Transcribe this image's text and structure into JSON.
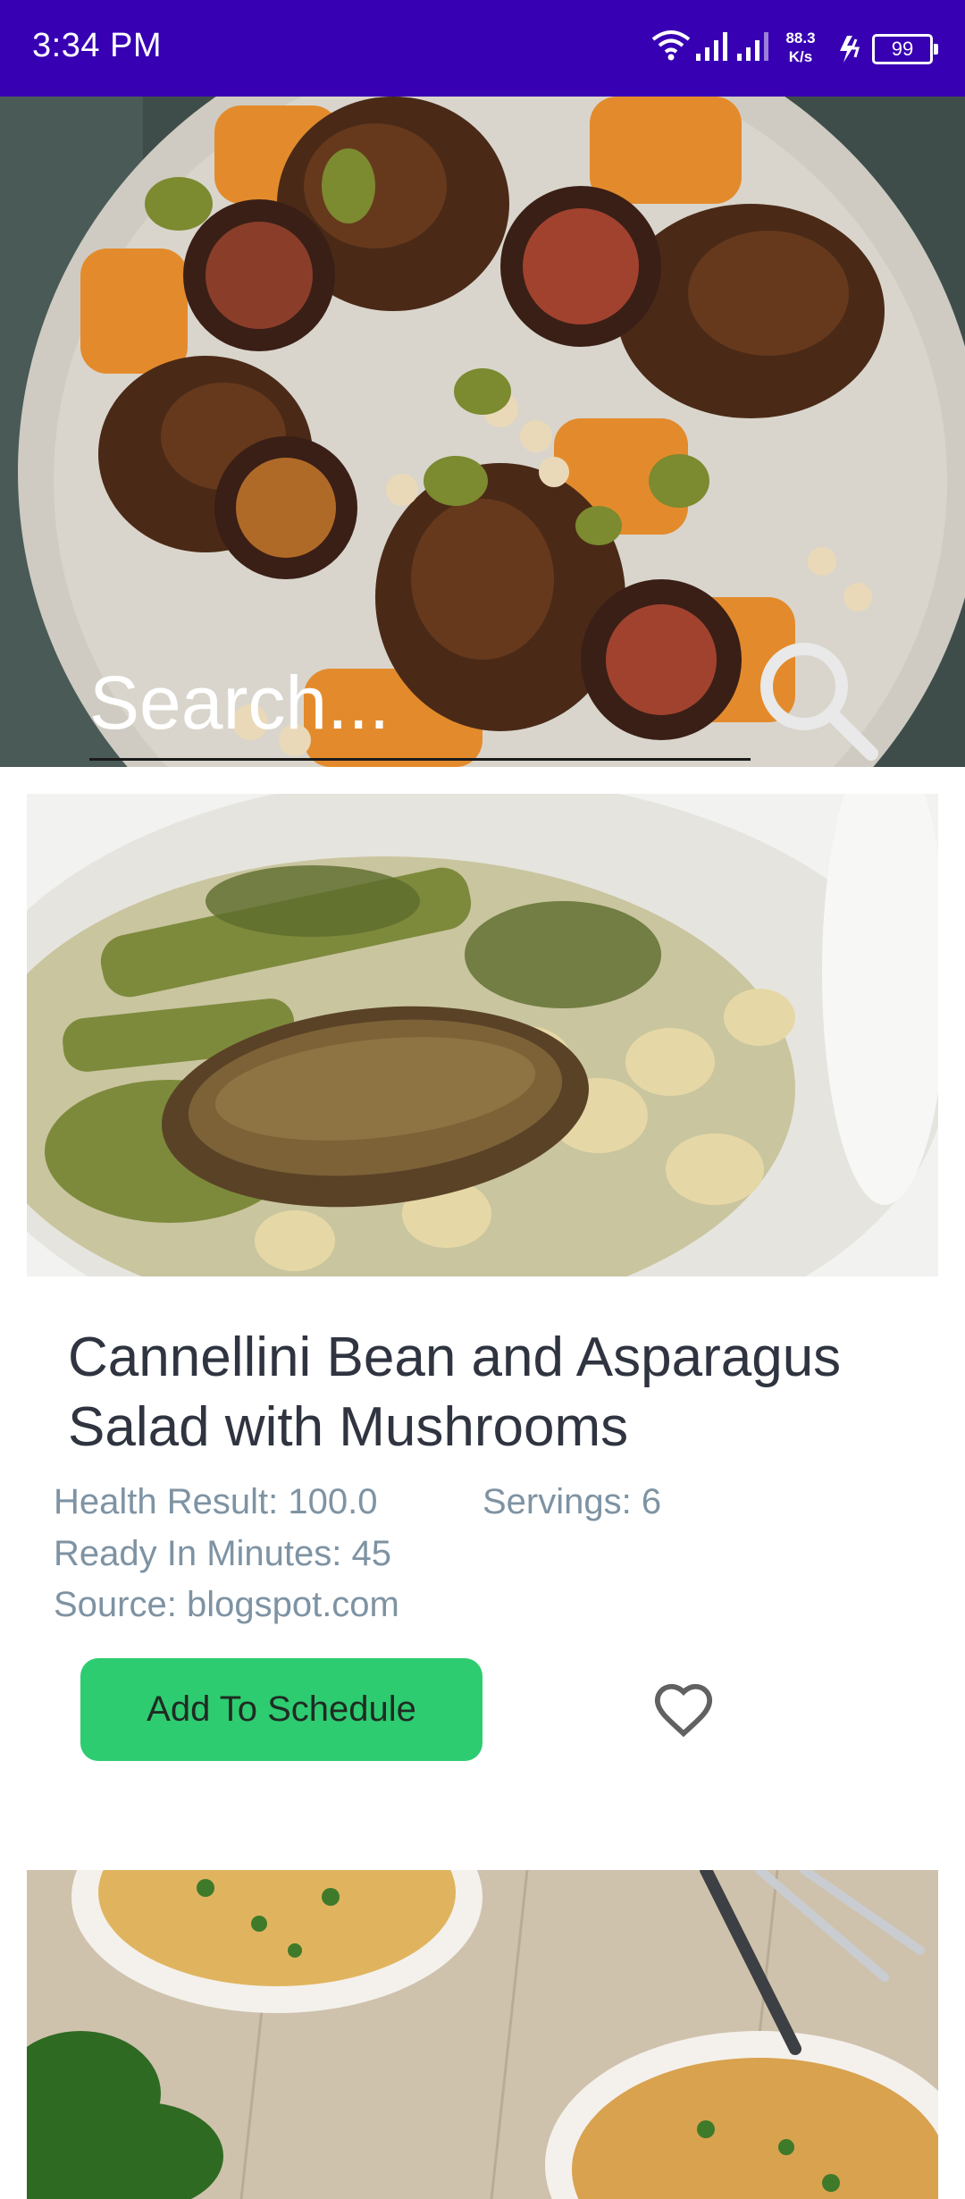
{
  "status_bar": {
    "time": "3:34 PM",
    "net_speed_value": "88.3",
    "net_speed_unit": "K/s",
    "battery_level": "99",
    "icons": [
      "wifi-icon",
      "signal-icon",
      "signal-icon",
      "charge-icon",
      "battery-icon"
    ]
  },
  "search": {
    "placeholder": "Search...",
    "icon": "search-icon",
    "background_image": "roasted chicken with blood oranges, olives, chickpeas and squash on a plate"
  },
  "recipes": [
    {
      "image": "cannellini beans with asparagus and mushrooms in a white bowl",
      "title": "Cannellini Bean and Asparagus Salad with Mushrooms",
      "health_result": "Health Result: 100.0",
      "servings": "Servings: 6",
      "ready_in": "Ready In Minutes: 45",
      "source": "Source: blogspot.com",
      "schedule_label": "Add To Schedule",
      "favorite_icon": "heart-outline-icon"
    },
    {
      "image": "bowls of white bean soup with herbs on a wooden table"
    }
  ],
  "colors": {
    "status_bar": "#3700b3",
    "button": "#2ecc71",
    "meta_text": "#7e93a3",
    "title_text": "#2f3440"
  }
}
